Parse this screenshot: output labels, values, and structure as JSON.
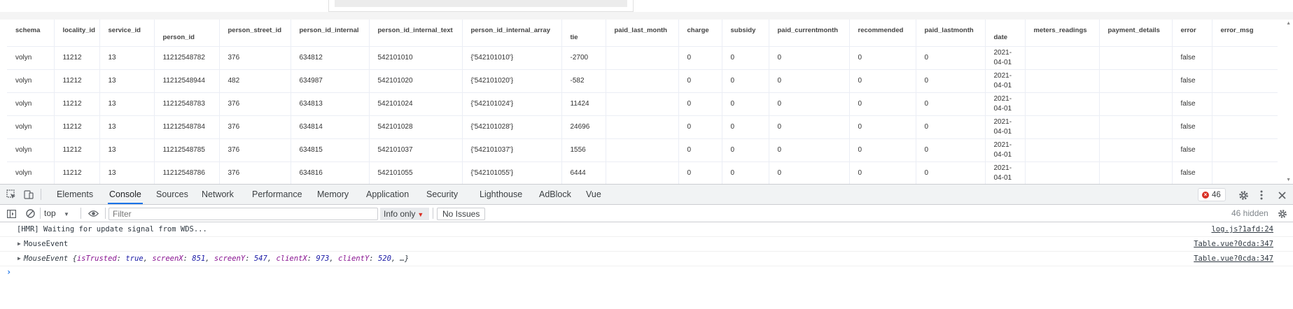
{
  "table": {
    "headers": [
      "schema",
      "locality_id",
      "service_id",
      "person_id",
      "person_street_id",
      "person_id_internal",
      "person_id_internal_text",
      "person_id_internal_array",
      "tie",
      "paid_last_month",
      "charge",
      "subsidy",
      "paid_currentmonth",
      "recommended",
      "paid_lastmonth",
      "date",
      "meters_readings",
      "payment_details",
      "error",
      "error_msg"
    ],
    "rows": [
      [
        "volyn",
        "11212",
        "13",
        "11212548782",
        "376",
        "634812",
        "542101010",
        "{'542101010'}",
        "-2700",
        "",
        "0",
        "0",
        "0",
        "0",
        "0",
        "2021-04-01",
        "",
        "",
        "false",
        ""
      ],
      [
        "volyn",
        "11212",
        "13",
        "11212548944",
        "482",
        "634987",
        "542101020",
        "{'542101020'}",
        "-582",
        "",
        "0",
        "0",
        "0",
        "0",
        "0",
        "2021-04-01",
        "",
        "",
        "false",
        ""
      ],
      [
        "volyn",
        "11212",
        "13",
        "11212548783",
        "376",
        "634813",
        "542101024",
        "{'542101024'}",
        "11424",
        "",
        "0",
        "0",
        "0",
        "0",
        "0",
        "2021-04-01",
        "",
        "",
        "false",
        ""
      ],
      [
        "volyn",
        "11212",
        "13",
        "11212548784",
        "376",
        "634814",
        "542101028",
        "{'542101028'}",
        "24696",
        "",
        "0",
        "0",
        "0",
        "0",
        "0",
        "2021-04-01",
        "",
        "",
        "false",
        ""
      ],
      [
        "volyn",
        "11212",
        "13",
        "11212548785",
        "376",
        "634815",
        "542101037",
        "{'542101037'}",
        "1556",
        "",
        "0",
        "0",
        "0",
        "0",
        "0",
        "2021-04-01",
        "",
        "",
        "false",
        ""
      ],
      [
        "volyn",
        "11212",
        "13",
        "11212548786",
        "376",
        "634816",
        "542101055",
        "{'542101055'}",
        "6444",
        "",
        "0",
        "0",
        "0",
        "0",
        "0",
        "2021-04-01",
        "",
        "",
        "false",
        ""
      ]
    ]
  },
  "devtools": {
    "tabs": [
      "Elements",
      "Console",
      "Sources",
      "Network",
      "Performance",
      "Memory",
      "Application",
      "Security",
      "Lighthouse",
      "AdBlock",
      "Vue"
    ],
    "active_tab": "Console",
    "error_count": "46",
    "toolbar": {
      "context": "top",
      "filter_placeholder": "Filter",
      "level": "Info only",
      "issues": "No Issues",
      "hidden": "46 hidden"
    },
    "console": {
      "line1": {
        "text": "[HMR] Waiting for update signal from WDS...",
        "source": "log.js?1afd:24"
      },
      "line2": {
        "text": "MouseEvent",
        "source": "Table.vue?0cda:347"
      },
      "line3": {
        "prefix": "MouseEvent {",
        "k1": "isTrusted",
        "v1": "true",
        "k2": "screenX",
        "v2": "851",
        "k3": "screenY",
        "v3": "547",
        "k4": "clientX",
        "v4": "973",
        "k5": "clientY",
        "v5": "520",
        "suffix": ", …}",
        "source": "Table.vue?0cda:347"
      }
    }
  },
  "colors": {
    "accent": "#1a73e8",
    "error": "#d93025"
  },
  "icons": [
    "inspect-icon",
    "device-toggle-icon",
    "close-icon",
    "settings-gear-icon",
    "more-vert-icon",
    "sidebar-toggle-icon",
    "clear-console-icon",
    "eye-icon",
    "caret-icon"
  ]
}
